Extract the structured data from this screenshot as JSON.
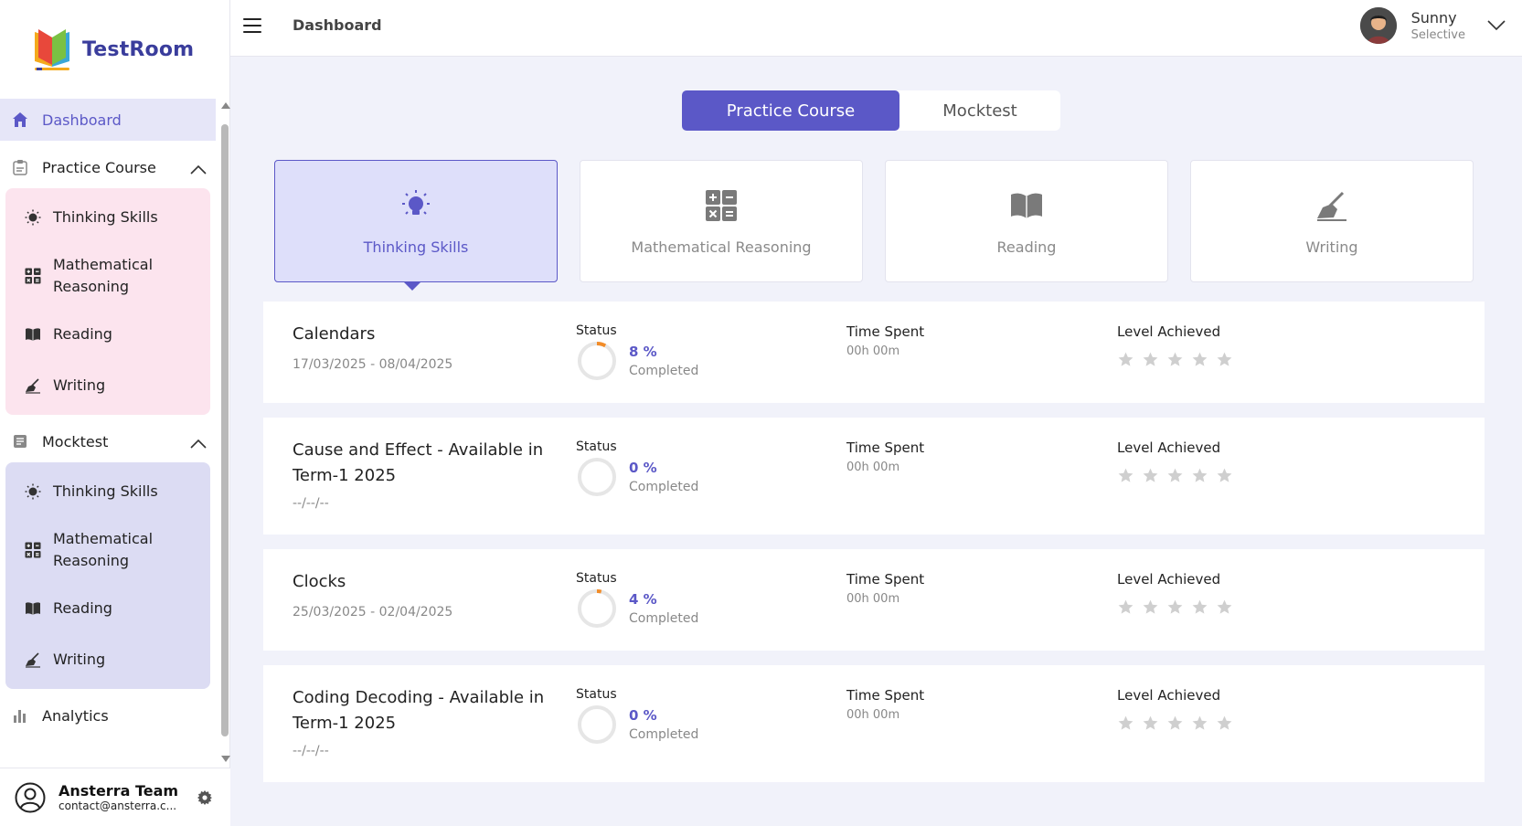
{
  "app": {
    "name": "TestRoom"
  },
  "header": {
    "title": "Dashboard",
    "user_name": "Sunny",
    "user_role": "Selective"
  },
  "sidebar": {
    "dashboard": "Dashboard",
    "practice_course": {
      "label": "Practice Course",
      "items": [
        "Thinking Skills",
        "Mathematical Reasoning",
        "Reading",
        "Writing"
      ]
    },
    "mocktest": {
      "label": "Mocktest",
      "items": [
        "Thinking Skills",
        "Mathematical Reasoning",
        "Reading",
        "Writing"
      ]
    },
    "analytics": "Analytics",
    "footer": {
      "name": "Ansterra Team",
      "email": "contact@ansterra.c..."
    }
  },
  "tabs": {
    "active": "Practice Course",
    "inactive": "Mocktest"
  },
  "subjects": [
    {
      "label": "Thinking Skills",
      "icon": "lightbulb-icon",
      "active": true
    },
    {
      "label": "Mathematical Reasoning",
      "icon": "calculator-icon",
      "active": false
    },
    {
      "label": "Reading",
      "icon": "book-icon",
      "active": false
    },
    {
      "label": "Writing",
      "icon": "writing-hand-icon",
      "active": false
    }
  ],
  "columns": {
    "status": "Status",
    "time": "Time Spent",
    "level": "Level Achieved",
    "completed": "Completed"
  },
  "courses": [
    {
      "title": "Calendars",
      "date": "17/03/2025 - 08/04/2025",
      "percent_label": "8 %",
      "percent": 8,
      "time": "00h 00m",
      "stars": 0
    },
    {
      "title": "Cause and Effect - Available in Term-1 2025",
      "date": "--/--/--",
      "percent_label": "0 %",
      "percent": 0,
      "time": "00h 00m",
      "stars": 0
    },
    {
      "title": "Clocks",
      "date": "25/03/2025 - 02/04/2025",
      "percent_label": "4 %",
      "percent": 4,
      "time": "00h 00m",
      "stars": 0
    },
    {
      "title": "Coding Decoding - Available in Term-1 2025",
      "date": "--/--/--",
      "percent_label": "0 %",
      "percent": 0,
      "time": "00h 00m",
      "stars": 0
    }
  ],
  "colors": {
    "accent": "#5b58c7",
    "progress": "#f28c28",
    "ring": "#e6e6e6",
    "star": "#cfcfcf"
  }
}
